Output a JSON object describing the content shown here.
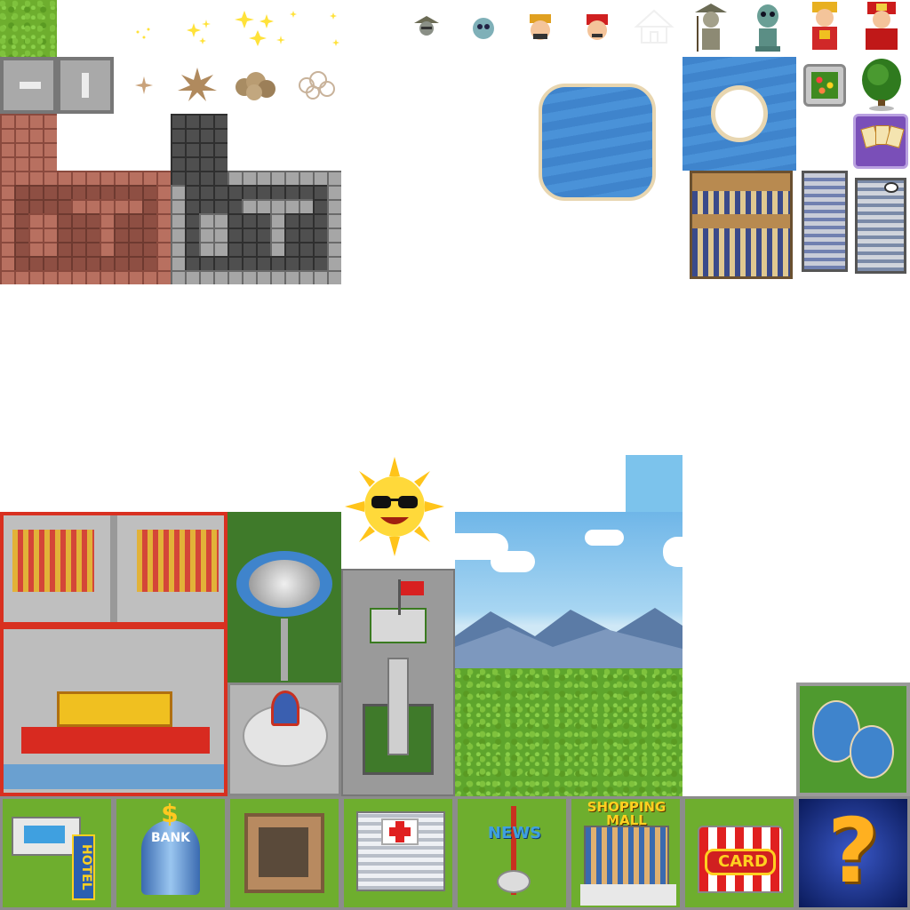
{
  "sheet": {
    "description_colors": {
      "grass": "#6eae2e",
      "water": "#3f84cc",
      "brick_red": "#b87060",
      "brick_grey": "#a6a6a6",
      "sky": "#7cc3ec",
      "road": "#9a9a9a"
    }
  },
  "sprites": {
    "characters": [
      {
        "name": "hat-man-small-icon"
      },
      {
        "name": "alien-small-icon"
      },
      {
        "name": "god-of-wealth-small-icon"
      },
      {
        "name": "red-hat-man-small-icon"
      },
      {
        "name": "house-outline-icon"
      },
      {
        "name": "hat-man-large-icon"
      },
      {
        "name": "alien-large-icon"
      },
      {
        "name": "god-of-wealth-large-icon"
      },
      {
        "name": "red-hat-man-large-icon"
      }
    ],
    "buildings": {
      "hotel_label": "HOTEL",
      "bank_label": "BANK",
      "bank_symbol": "$",
      "news_label": "NEWS",
      "shopping_label": "SHOPPING MALL",
      "card_label": "CARD",
      "chance_label": "?"
    }
  }
}
